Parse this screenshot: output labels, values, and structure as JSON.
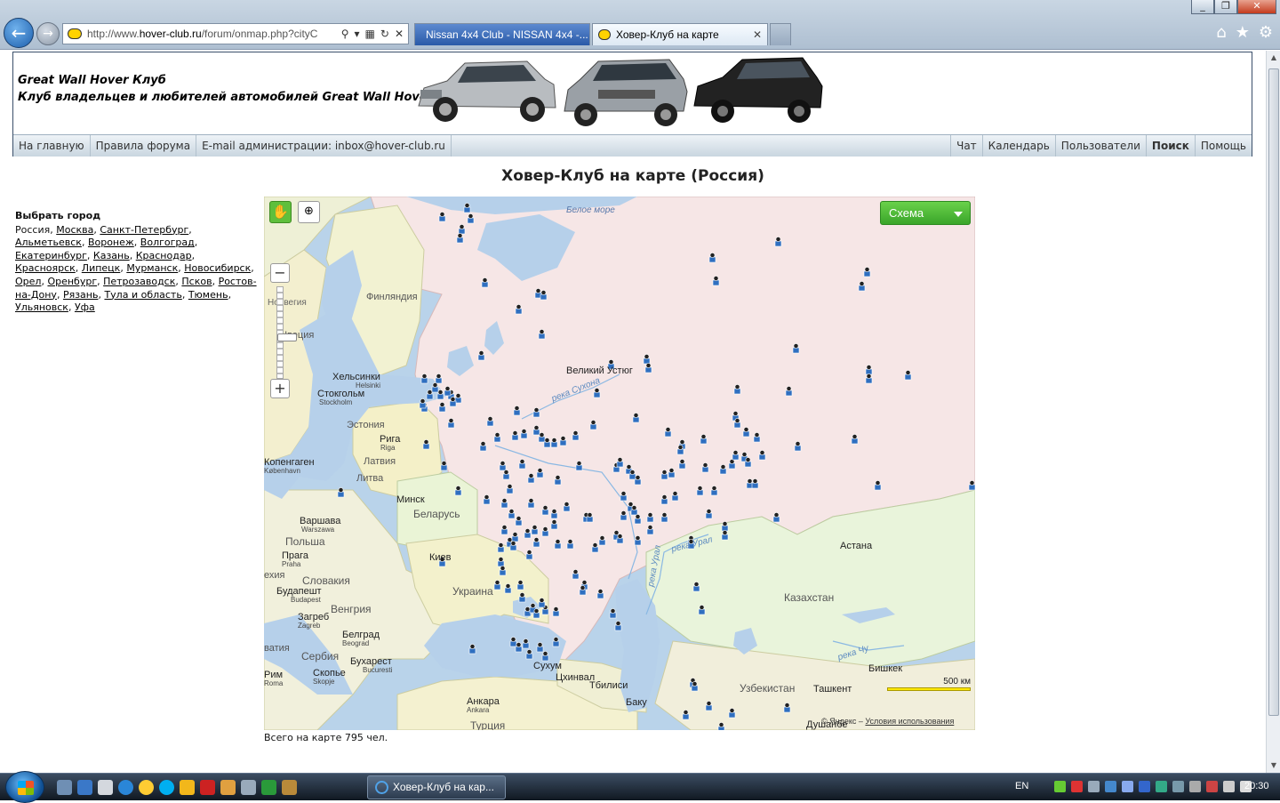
{
  "browser": {
    "url_prefix": "http://www.",
    "url_host": "hover-club.ru",
    "url_path": "/forum/onmap.php?cityC",
    "tabs": [
      {
        "label": "Nissan 4x4 Club - NISSAN 4x4 -..."
      },
      {
        "label": "Ховер-Клуб на карте"
      }
    ]
  },
  "header": {
    "title": "Great Wall Hover Клуб",
    "subtitle": "Клуб владельцев и любителей автомобилей Great Wall Hover",
    "nav_left": [
      "На главную",
      "Правила форума",
      "E-mail администрации:  inbox@hover-club.ru"
    ],
    "nav_right": [
      "Чат",
      "Календарь",
      "Пользователи",
      "Поиск",
      "Помощь"
    ]
  },
  "page": {
    "title": "Ховер-Клуб на карте (Россия)",
    "choose_city": "Выбрать город",
    "current_city": "Россия",
    "cities": [
      "Москва",
      "Санкт-Петербург",
      "Альметьевск",
      "Воронеж",
      "Волгоград",
      "Екатеринбург",
      "Казань",
      "Краснодар",
      "Красноярск",
      "Липецк",
      "Мурманск",
      "Новосибирск",
      "Орел",
      "Оренбург",
      "Петрозаводск",
      "Псков",
      "Ростов-на-Дону",
      "Рязань",
      "Тула и область",
      "Тюмень",
      "Ульяновск",
      "Уфа"
    ],
    "total": "Всего на карте 795 чел."
  },
  "map": {
    "layer_button": "Схема",
    "scale_label": "500 км",
    "copyright": "© Яндекс –",
    "terms": "Условия использования",
    "labels": {
      "white_sea": "Белое море",
      "finland": "Финляндия",
      "sweden": "Швеция",
      "norway": "Норвегия",
      "helsinki": "Хельсинки",
      "helsinki_lat": "Helsinki",
      "stockholm": "Стокгольм",
      "stockholm_lat": "Stockholm",
      "estonia": "Эстония",
      "riga": "Рига",
      "riga_lat": "Riga",
      "latvia": "Латвия",
      "lithuania": "Литва",
      "copenhagen": "Копенгаген",
      "copenhagen_lat": "København",
      "minsk": "Минск",
      "belarus": "Беларусь",
      "warsaw": "Варшава",
      "warsaw_lat": "Warszawa",
      "poland": "Польша",
      "prague": "Прага",
      "prague_lat": "Praha",
      "kiev": "Киев",
      "slovakia": "Словакия",
      "czech": "ехия",
      "budapest": "Будапешт",
      "budapest_lat": "Budapest",
      "hungary": "Венгрия",
      "ukraine": "Украина",
      "zagreb": "Загреб",
      "zagreb_lat": "Zagreb",
      "belgrade": "Белград",
      "belgrade_lat": "Beograd",
      "croatia": "ватия",
      "serbia": "Сербия",
      "bucharest": "Бухарест",
      "bucharest_lat": "Bucuresti",
      "rome": "Рим",
      "rome_lat": "Roma",
      "skopje": "Скопье",
      "skopje_lat": "Skopje",
      "ankara": "Анкара",
      "ankara_lat": "Ankara",
      "turkey": "Турция",
      "sukhum": "Сухум",
      "tskhinval": "Цхинвал",
      "tbilisi": "Тбилиси",
      "baku": "Баку",
      "velikiy_ustyug": "Великий Устюг",
      "sukhona": "река Сухона",
      "ural": "река Урал",
      "ural2": "река Урал",
      "chu": "река Чу",
      "astana": "Астана",
      "kazakhstan": "Казахстан",
      "bishkek": "Бишкек",
      "uzbekistan": "Узбекистан",
      "tashkent": "Ташкент",
      "dushanbe": "Душанбе"
    }
  },
  "taskbar": {
    "active_window": "Ховер-Клуб на кар...",
    "language": "EN",
    "clock": "20:30"
  }
}
